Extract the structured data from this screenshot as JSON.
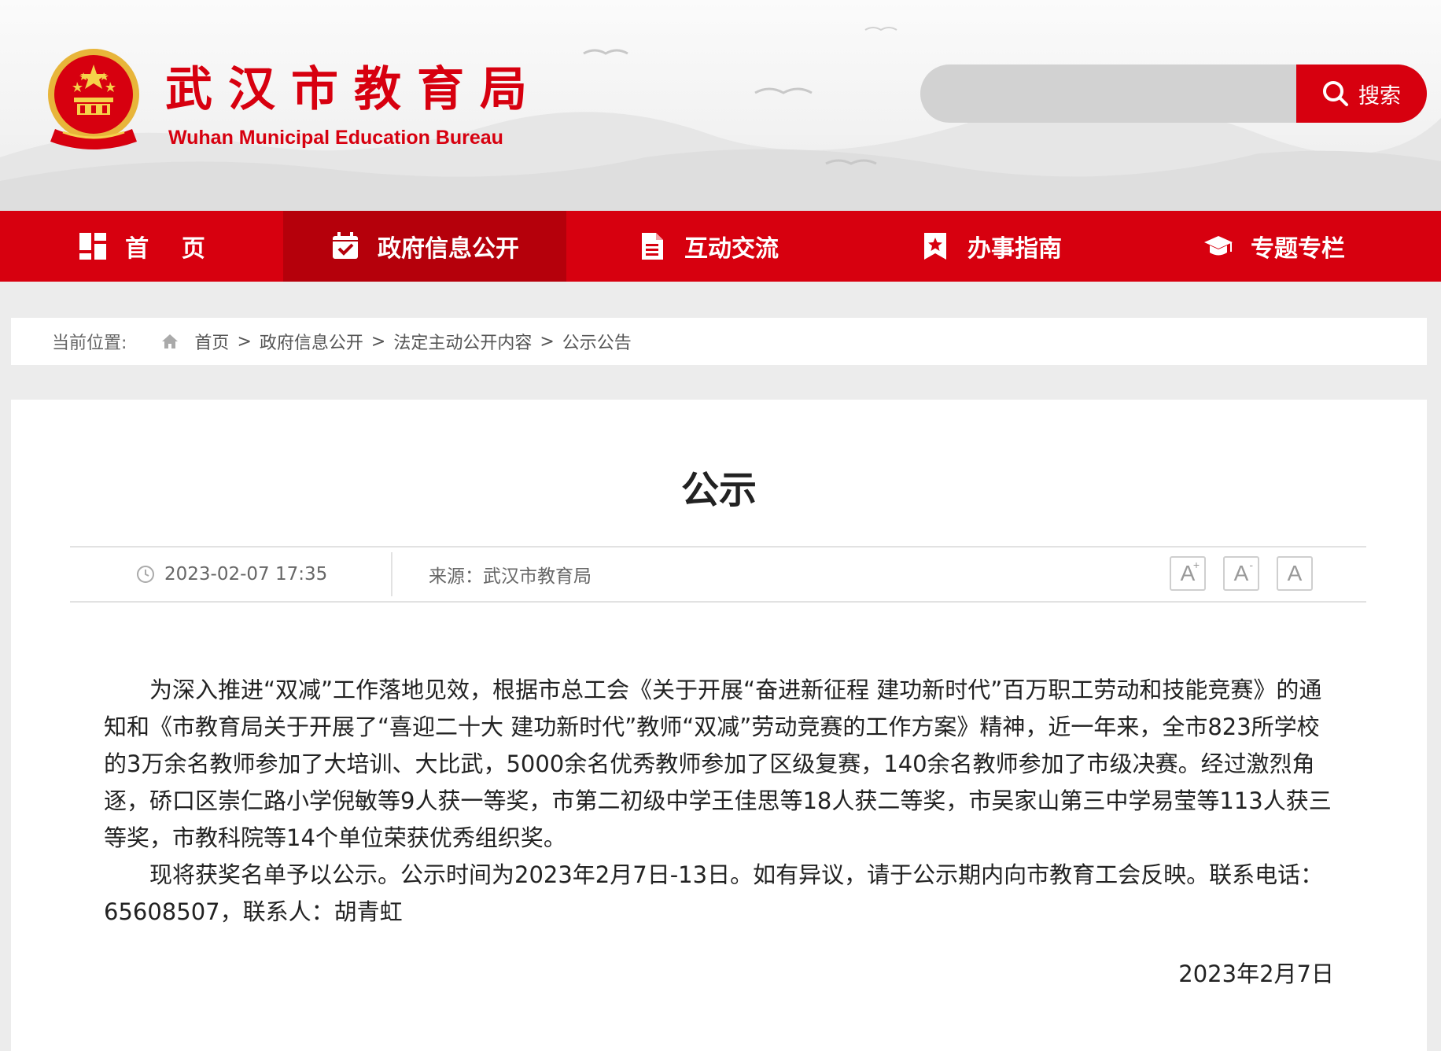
{
  "header": {
    "title": "武汉市教育局",
    "subtitle": "Wuhan Municipal Education Bureau",
    "emblem_icon": "national-emblem-icon",
    "search": {
      "placeholder": "",
      "button_label": "搜索",
      "icon": "search-icon"
    }
  },
  "nav": {
    "items": [
      {
        "label": "首    页",
        "icon": "grid-icon",
        "active": false
      },
      {
        "label": "政府信息公开",
        "icon": "calendar-check-icon",
        "active": true
      },
      {
        "label": "互动交流",
        "icon": "document-icon",
        "active": false
      },
      {
        "label": "办事指南",
        "icon": "bookmark-star-icon",
        "active": false
      },
      {
        "label": "专题专栏",
        "icon": "graduation-cap-icon",
        "active": false
      }
    ]
  },
  "breadcrumb": {
    "label": "当前位置:",
    "items": [
      "首页",
      "政府信息公开",
      "法定主动公开内容",
      "公示公告"
    ],
    "separator": ">"
  },
  "article": {
    "title": "公示",
    "time": "2023-02-07 17:35",
    "source": "来源：武汉市教育局",
    "font_buttons": [
      "A",
      "A",
      "A"
    ],
    "font_button_marks": [
      "+",
      "-",
      ""
    ],
    "paragraphs": [
      "为深入推进“双减”工作落地见效，根据市总工会《关于开展“奋进新征程 建功新时代”百万职工劳动和技能竞赛》的通知和《市教育局关于开展了“喜迎二十大 建功新时代”教师“双减”劳动竞赛的工作方案》精神，近一年来，全市823所学校的3万余名教师参加了大培训、大比武，5000余名优秀教师参加了区级复赛，140余名教师参加了市级决赛。经过激烈角逐，硚口区崇仁路小学倪敏等9人获一等奖，市第二初级中学王佳思等18人获二等奖，市吴家山第三中学易莹等113人获三等奖，市教科院等14个单位荣获优秀组织奖。",
      "现将获奖名单予以公示。公示时间为2023年2月7日-13日。如有异议，请于公示期内向市教育工会反映。联系电话：65608507，联系人：胡青虹"
    ],
    "date": "2023年2月7日"
  },
  "colors": {
    "brand_red": "#d7000f",
    "nav_active": "#b5000b"
  }
}
